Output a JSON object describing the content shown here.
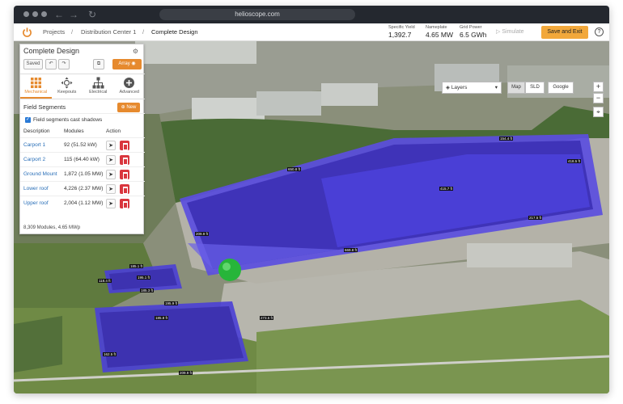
{
  "browser": {
    "url": "helioscope.com"
  },
  "breadcrumb": {
    "items": [
      "Projects",
      "Distribution Center 1",
      "Complete Design"
    ],
    "separator": "/"
  },
  "stats": [
    {
      "label": "Specific Yield",
      "value": "1,392.7"
    },
    {
      "label": "Nameplate",
      "value": "4.65 MW"
    },
    {
      "label": "Grid Power",
      "value": "6.5 GWh"
    }
  ],
  "actions": {
    "simulate": "Simulate",
    "save_exit": "Save and Exit",
    "help": "?"
  },
  "panel": {
    "title": "Complete Design",
    "saved": "Saved",
    "array": "Array",
    "tabs": [
      "Mechanical",
      "Keepouts",
      "Electrical",
      "Advanced"
    ],
    "field_segments_title": "Field Segments",
    "new_label": "New",
    "shadow_checkbox": "Field segments cast shadows",
    "columns": [
      "Description",
      "Modules",
      "Action"
    ],
    "rows": [
      {
        "description": "Carport 1",
        "modules": "92 (51.52 kW)"
      },
      {
        "description": "Carport 2",
        "modules": "115 (64.40 kW)"
      },
      {
        "description": "Ground Mount",
        "modules": "1,872 (1.05 MW)"
      },
      {
        "description": "Lower roof",
        "modules": "4,226 (2.37 MW)"
      },
      {
        "description": "Upper roof",
        "modules": "2,004 (1.12 MW)"
      }
    ],
    "summary": "8,309 Modules, 4.65 MWp"
  },
  "map_controls": {
    "layers": "Layers",
    "types": [
      "Map",
      "SLD",
      "Google"
    ],
    "zoom_in": "+",
    "zoom_out": "−",
    "locate": "⌖"
  },
  "dimensions": [
    "650.8 ft",
    "154.4 ft",
    "418.5 ft",
    "217.5 ft",
    "209.9 ft",
    "669.8 ft",
    "415.7 ft",
    "185.1 ft",
    "195.1 ft",
    "185.3 ft",
    "195.9 ft",
    "185.8 ft",
    "273.5 ft",
    "162.5 ft",
    "209.9 ft",
    "118.4 ft"
  ],
  "colors": {
    "accent": "#e68a2e",
    "array_fill": "#4a3fd6",
    "save_button": "#f2a83b",
    "delete": "#d9363e"
  }
}
